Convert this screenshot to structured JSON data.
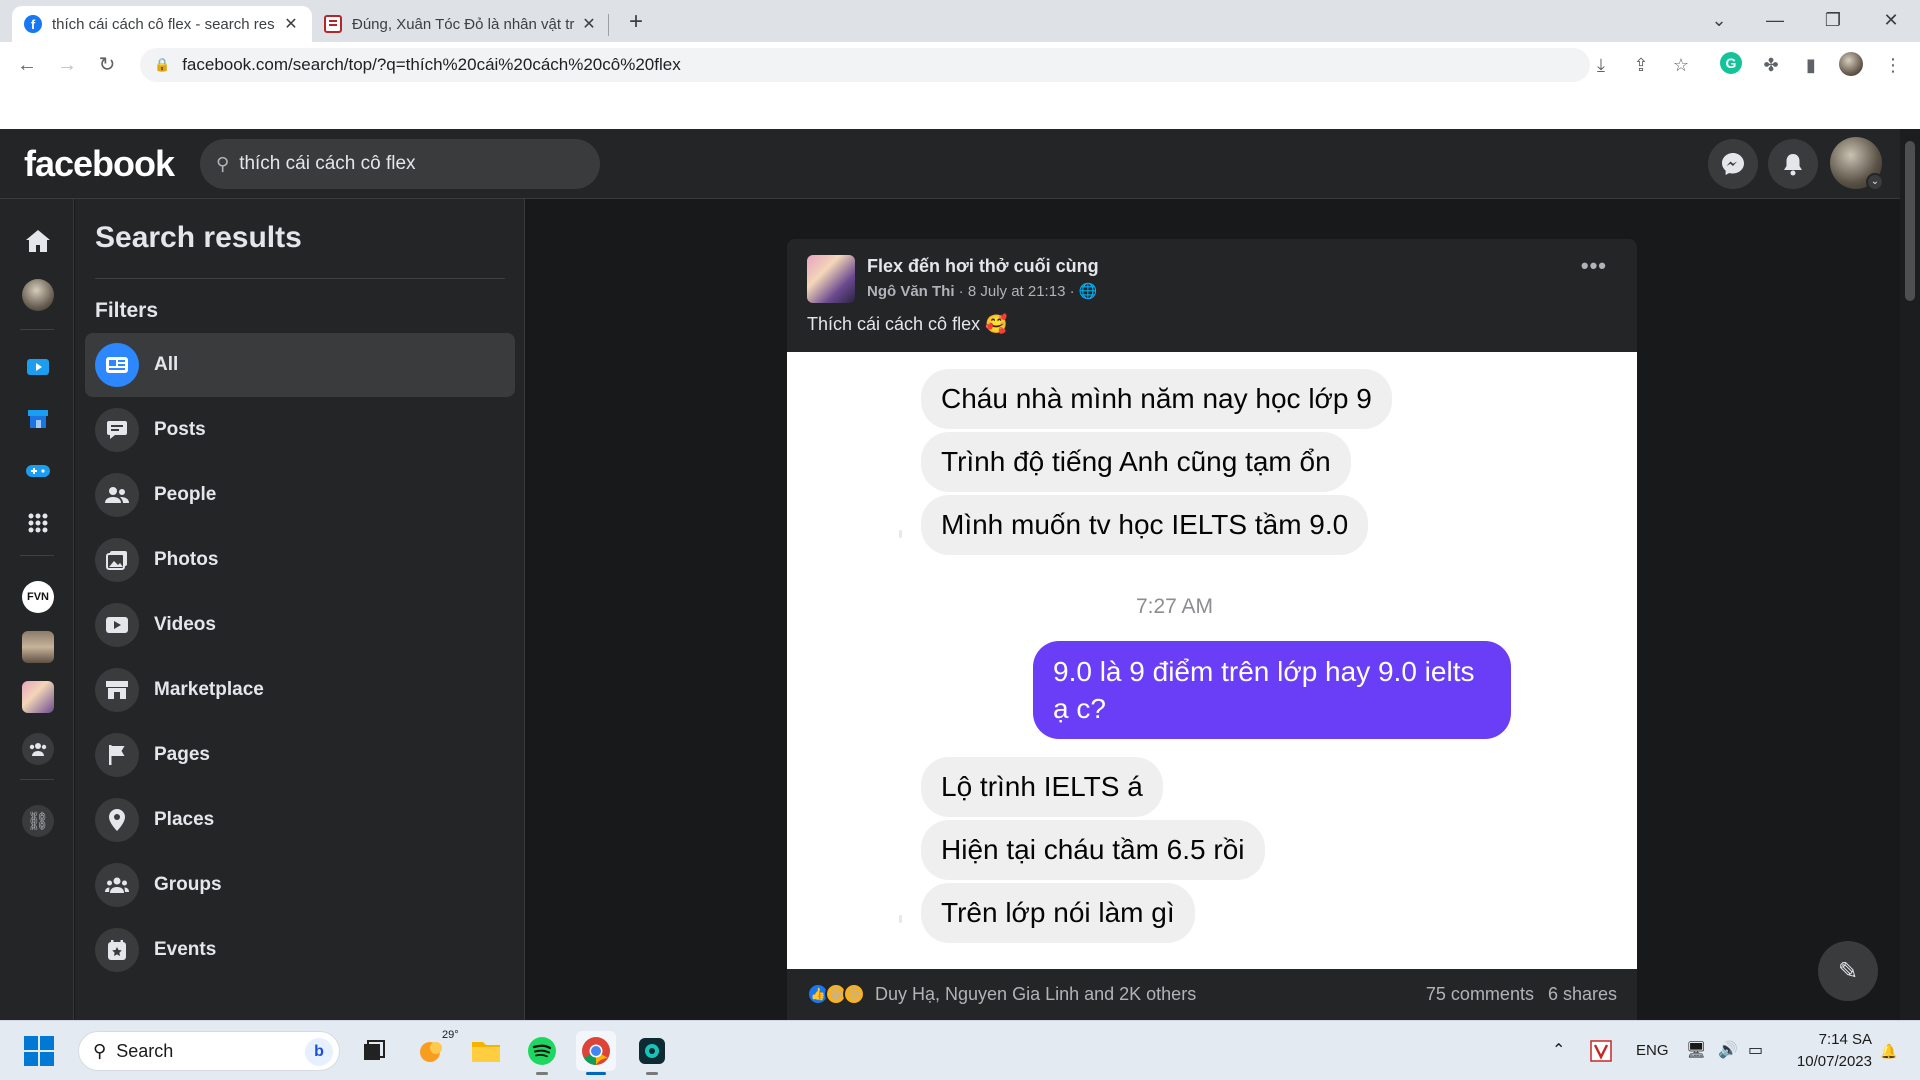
{
  "browser": {
    "tabs": [
      {
        "title": "thích cái cách cô flex - search res",
        "active": true,
        "icon": "facebook-icon"
      },
      {
        "title": "Đúng, Xuân Tóc Đỏ là nhân vật tr",
        "active": false,
        "icon": "doc-icon"
      }
    ],
    "address": "facebook.com/search/top/?q=thích%20cái%20cách%20cô%20flex"
  },
  "fb": {
    "logo": "facebook",
    "search_value": "thích cái cách cô flex",
    "panel_title": "Search results",
    "filters_title": "Filters",
    "filters": [
      {
        "label": "All",
        "icon": "newsfeed-icon",
        "active": true
      },
      {
        "label": "Posts",
        "icon": "posts-icon"
      },
      {
        "label": "People",
        "icon": "people-icon"
      },
      {
        "label": "Photos",
        "icon": "photos-icon"
      },
      {
        "label": "Videos",
        "icon": "videos-icon"
      },
      {
        "label": "Marketplace",
        "icon": "marketplace-icon"
      },
      {
        "label": "Pages",
        "icon": "pages-flag-icon"
      },
      {
        "label": "Places",
        "icon": "places-pin-icon"
      },
      {
        "label": "Groups",
        "icon": "groups-icon"
      },
      {
        "label": "Events",
        "icon": "events-icon"
      }
    ]
  },
  "post": {
    "group_name": "Flex đến hơi thở cuối cùng",
    "author": "Ngô Văn Thi",
    "date": "8 July at 21:13",
    "text": "Thích cái cách cô flex 🥰",
    "chat": {
      "incoming_1": [
        "Cháu nhà mình năm nay học lớp 9",
        "Trình độ tiếng Anh cũng tạm ổn",
        "Mình muốn tv học IELTS tầm 9.0"
      ],
      "timestamp": "7:27 AM",
      "outgoing": "9.0 là 9 điểm trên lớp hay 9.0 ielts ạ c?",
      "incoming_2": [
        "Lộ trình IELTS á",
        "Hiện tại cháu tầm 6.5 rồi",
        "Trên lớp nói làm gì"
      ]
    },
    "reactions_text": "Duy Hạ, Nguyen Gia Linh and 2K others",
    "comments": "75 comments",
    "shares": "6 shares"
  },
  "taskbar": {
    "search_placeholder": "Search",
    "weather": "29°",
    "lang": "ENG",
    "time": "7:14 SA",
    "date": "10/07/2023"
  },
  "colors": {
    "fb_dark_bg": "#18191a",
    "fb_surface": "#242526",
    "fb_blue": "#2d88ff",
    "messenger_purple": "#6a3ef7"
  }
}
